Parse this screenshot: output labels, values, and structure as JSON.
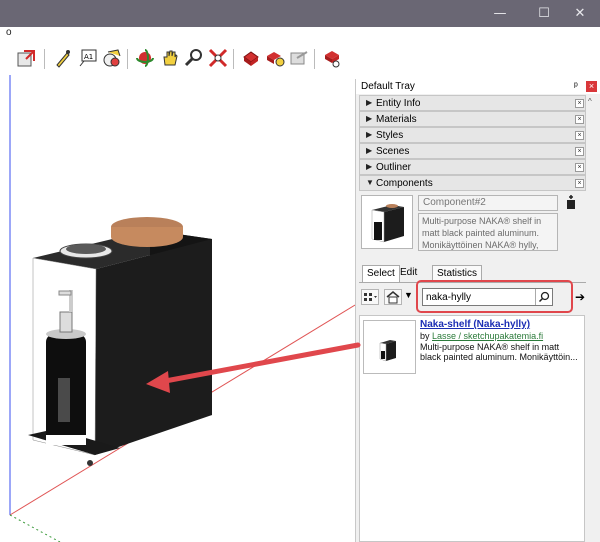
{
  "window": {
    "minimize_glyph": "—",
    "maximize_glyph": "☐",
    "close_glyph": "✕",
    "menu_fragment": "o"
  },
  "toolbar": {
    "icons": [
      "make-component-icon",
      "paint-icon",
      "text-label-icon",
      "dimension-icon",
      "orbit-icon",
      "pan-icon",
      "zoom-icon",
      "zoom-extents-icon",
      "3d-warehouse-icon",
      "get-models-icon",
      "share-model-icon",
      "extension-warehouse-icon"
    ]
  },
  "tray": {
    "title": "Default Tray",
    "pin_glyph": "ᵖ",
    "close_glyph": "×",
    "panels": [
      {
        "label": "Entity Info",
        "expanded": false
      },
      {
        "label": "Materials",
        "expanded": false
      },
      {
        "label": "Styles",
        "expanded": false
      },
      {
        "label": "Scenes",
        "expanded": false
      },
      {
        "label": "Outliner",
        "expanded": false
      },
      {
        "label": "Components",
        "expanded": true
      }
    ],
    "panel_close": "×"
  },
  "components": {
    "name": "Component#2",
    "description": "Multi-purpose NAKA® shelf in matt black painted aluminum. Monikäyttöinen NAKA® hylly,",
    "tabs": {
      "select": "Select",
      "edit": "Edit",
      "statistics": "Statistics"
    },
    "search": {
      "value": "naka-hylly"
    },
    "results": [
      {
        "title": "Naka-shelf (Naka-hylly)",
        "by_prefix": "by ",
        "author": "Lasse / sketchupakatemia.fi",
        "description": "Multi-purpose NAKA® shelf in matt black painted aluminum. Monikäyttöin..."
      }
    ]
  },
  "colors": {
    "titlebar": "#6a6774",
    "highlight": "#e0474c",
    "link": "#1b2db4",
    "author_link": "#2c7b3b",
    "axis_red": "#e05555",
    "axis_blue": "#3a4ff0",
    "axis_green": "#3a9a3a"
  }
}
